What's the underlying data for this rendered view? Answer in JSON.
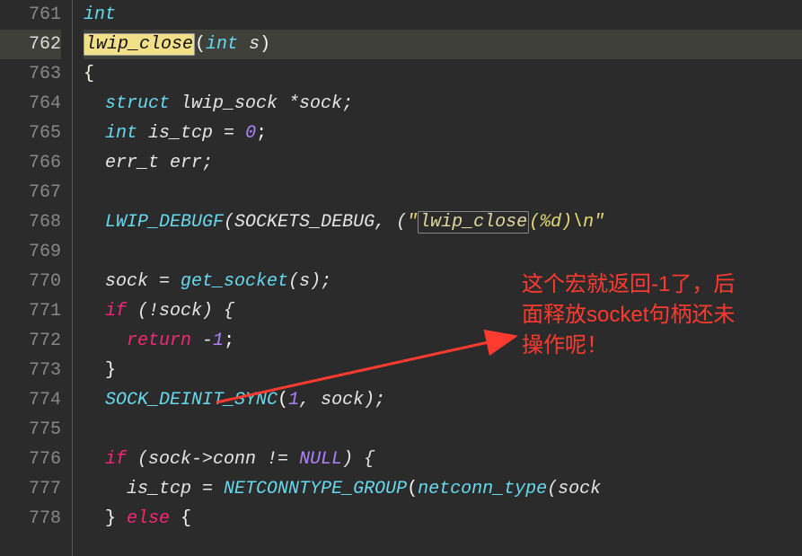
{
  "line_numbers": [
    "761",
    "762",
    "763",
    "764",
    "765",
    "766",
    "767",
    "768",
    "769",
    "770",
    "771",
    "772",
    "773",
    "774",
    "775",
    "776",
    "777",
    "778"
  ],
  "code": {
    "l761_kw": "int",
    "l762_fn": "lwip_close",
    "l762_p_open": "(",
    "l762_kw": "int",
    "l762_arg": " s",
    "l762_p_close": ")",
    "l763": "{",
    "l764_kw": "struct",
    "l764_rest": " lwip_sock *sock;",
    "l765_kw": "int",
    "l765_rest": " is_tcp = ",
    "l765_num": "0",
    "l765_semi": ";",
    "l766": "err_t err;",
    "l768_macro": "LWIP_DEBUGF",
    "l768_open": "(SOCKETS_DEBUG, (",
    "l768_q": "\"",
    "l768_hl": "lwip_close",
    "l768_str": "(%d)\\n\"",
    "l770_lhs": "sock = ",
    "l770_call": "get_socket",
    "l770_tail": "(s);",
    "l771_if": "if",
    "l771_cond": " (!sock) {",
    "l772_ret": "return",
    "l772_val": " -",
    "l772_num": "1",
    "l772_semi": ";",
    "l773": "}",
    "l774_macro": "SOCK_DEINIT_SYNC",
    "l774_open": "(",
    "l774_num": "1",
    "l774_rest": ", sock);",
    "l776_if": "if",
    "l776_open": " (sock->conn != ",
    "l776_null": "NULL",
    "l776_close": ") {",
    "l777_lhs": "is_tcp = ",
    "l777_m": "NETCONNTYPE_GROUP",
    "l777_open": "(",
    "l777_call": "netconn_type",
    "l777_tail": "(sock",
    "l778_close": "} ",
    "l778_else": "else",
    "l778_brace": " {"
  },
  "annotation": {
    "line1": "这个宏就返回-1了，后",
    "line2": "面释放socket句柄还未",
    "line3": "操作呢！"
  },
  "current_line": "762"
}
